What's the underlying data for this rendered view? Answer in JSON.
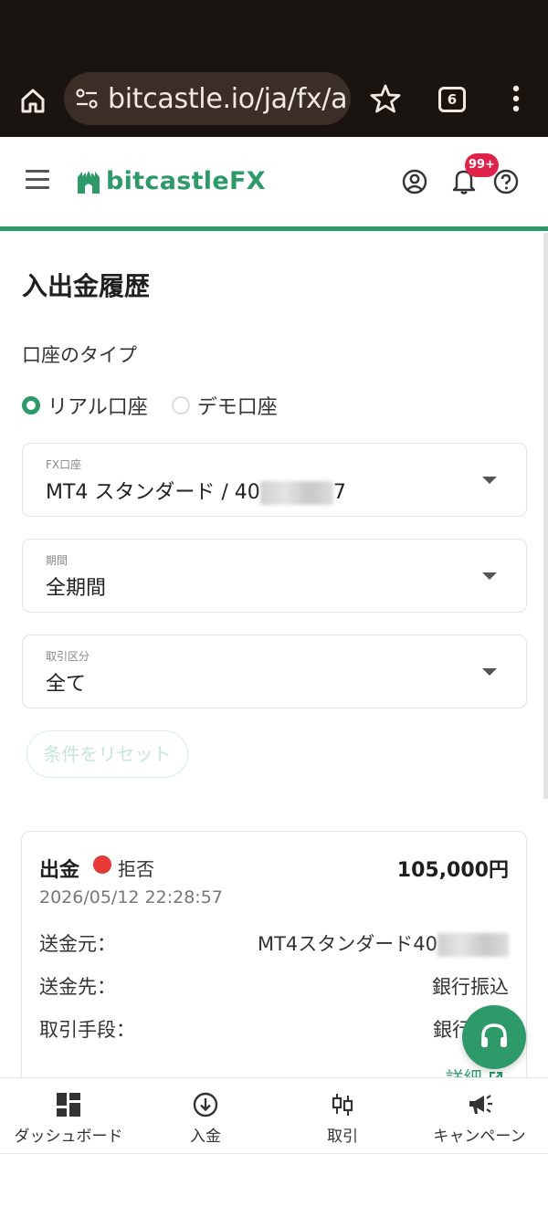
{
  "browser": {
    "url": "bitcastle.io/ja/fx/a",
    "tab_count": "6"
  },
  "header": {
    "logo_text": "bitcastle",
    "logo_fx": "FX",
    "notification_count": "99+"
  },
  "page": {
    "title": "入出金履歴",
    "account_type_label": "口座のタイプ",
    "radio_real": "リアル口座",
    "radio_demo": "デモ口座"
  },
  "filters": {
    "fx_account": {
      "label": "FX口座",
      "value_prefix": "MT4 スタンダード / 40",
      "value_suffix": "7"
    },
    "period": {
      "label": "期間",
      "value": "全期間"
    },
    "category": {
      "label": "取引区分",
      "value": "全て"
    },
    "reset_label": "条件をリセット"
  },
  "record": {
    "type": "出金",
    "status": "拒否",
    "amount": "105,000円",
    "date": "2026/05/12 22:28:57",
    "rows": [
      {
        "label": "送金元：",
        "value": "MT4スタンダード40"
      },
      {
        "label": "送金先：",
        "value": "銀行振込"
      },
      {
        "label": "取引手段：",
        "value": "銀行"
      }
    ],
    "detail_label": "詳細"
  },
  "bottom_nav": [
    {
      "label": "ダッシュボード",
      "icon": "dashboard-icon"
    },
    {
      "label": "入金",
      "icon": "deposit-icon"
    },
    {
      "label": "取引",
      "icon": "candlestick-icon"
    },
    {
      "label": "キャンペーン",
      "icon": "megaphone-icon"
    }
  ],
  "colors": {
    "brand": "#2e9a6a",
    "reject": "#e53935",
    "badge": "#e0234a"
  }
}
